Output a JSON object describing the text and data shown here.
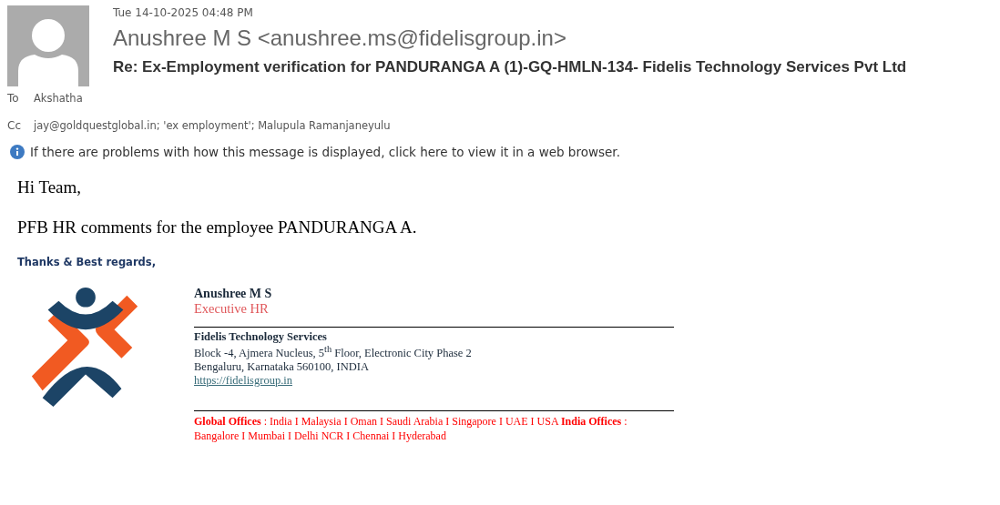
{
  "header": {
    "date": "Tue 14-10-2025 04:48 PM",
    "sender": "Anushree M S <anushree.ms@fidelisgroup.in>",
    "subject": "Re: Ex-Employment verification for PANDURANGA A (1)-GQ-HMLN-134- Fidelis Technology Services Pvt Ltd",
    "recipients": [
      {
        "label": "To",
        "value": "Akshatha"
      },
      {
        "label": "Cc",
        "value": "jay@goldquestglobal.in; 'ex employment'; Malupula Ramanjaneyulu"
      }
    ],
    "info": "If there are problems with how this message is displayed, click here to view it in a web browser."
  },
  "body": {
    "greeting": "Hi Team,",
    "message": "PFB HR comments for the employee PANDURANGA A.",
    "closing": "Thanks & Best regards,"
  },
  "signature": {
    "name": "Anushree  M S",
    "title": "Executive HR",
    "company": "Fidelis Technology Services",
    "address_lines": [
      "Block -4, Ajmera Nucleus, 5$^{th}$ Floor, Electronic City Phase 2",
      "Bengaluru, Karnataka 560100, INDIA"
    ],
    "website": "https://fidelisgroup.in",
    "offices": "**Global Offices** : India I Malaysia I Oman I Saudi Arabia I Singapore I UAE I USA **India Offices** : Bangalore I Mumbai I Delhi NCR I Chennai I Hyderabad"
  }
}
